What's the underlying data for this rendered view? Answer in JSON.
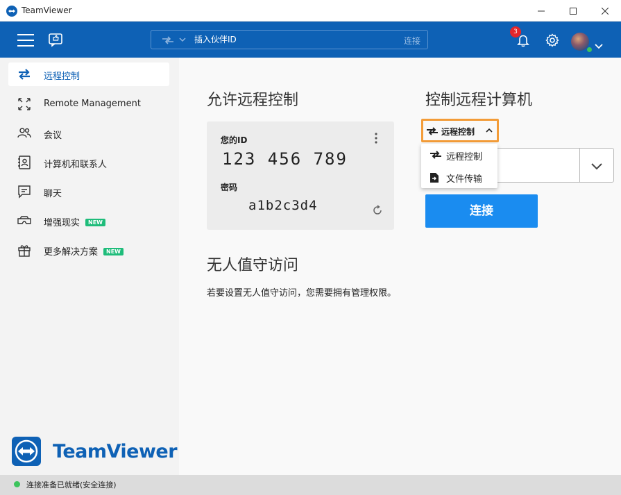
{
  "window": {
    "title": "TeamViewer"
  },
  "header": {
    "partner_placeholder": "插入伙伴ID",
    "connect_label": "连接",
    "notification_count": "3"
  },
  "sidebar": {
    "items": [
      {
        "label": "远程控制",
        "icon": "swap-arrows-icon",
        "active": true
      },
      {
        "label": "Remote Management",
        "icon": "expand-arrows-icon"
      },
      {
        "label": "会议",
        "icon": "people-icon"
      },
      {
        "label": "计算机和联系人",
        "icon": "contact-book-icon"
      },
      {
        "label": "聊天",
        "icon": "chat-icon"
      },
      {
        "label": "增强现实",
        "icon": "ar-goggles-icon",
        "badge": "NEW"
      },
      {
        "label": "更多解决方案",
        "icon": "gift-icon",
        "badge": "NEW"
      }
    ],
    "brand": "TeamViewer"
  },
  "allow": {
    "title": "允许远程控制",
    "id_label": "您的ID",
    "id_value": "123 456 789",
    "password_label": "密码",
    "password_value": "a1b2c3d4"
  },
  "unattended": {
    "title": "无人值守访问",
    "description": "若要设置无人值守访问，您需要拥有管理权限。"
  },
  "control": {
    "title": "控制远程计算机",
    "mode_label": "远程控制",
    "dropdown_items": [
      {
        "label": "远程控制",
        "icon": "swap-arrows-icon"
      },
      {
        "label": "文件传输",
        "icon": "file-transfer-icon"
      }
    ],
    "connect_button": "连接"
  },
  "status": {
    "text": "连接准备已就绪(安全连接)"
  },
  "colors": {
    "brand_blue": "#0e61b5",
    "connect_button": "#1a8cf0",
    "highlight_orange": "#f39c38",
    "new_badge": "#1ebc7a",
    "status_green": "#3cc45c"
  }
}
